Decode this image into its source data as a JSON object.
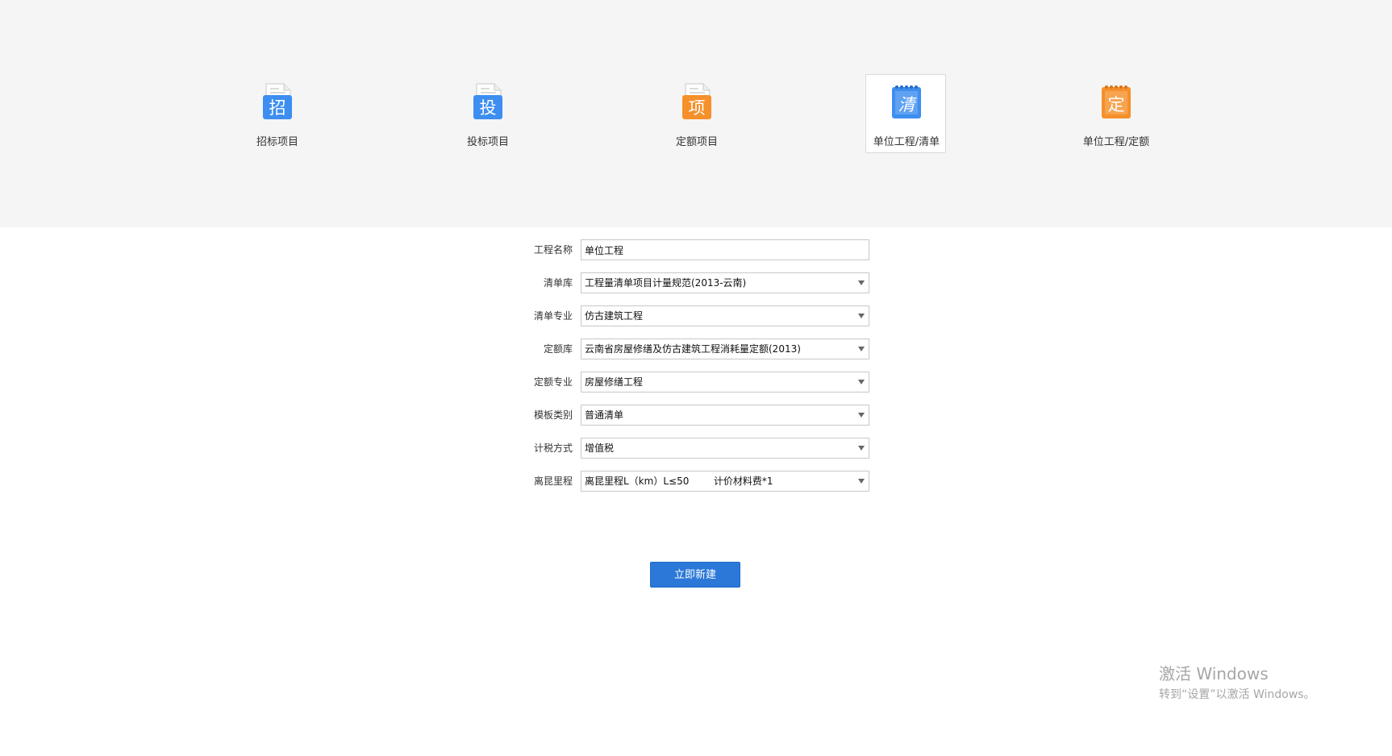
{
  "project_types": [
    {
      "label": "招标项目",
      "glyph": "招",
      "color": "#3d8ef0",
      "icon": "document-icon",
      "selected": false
    },
    {
      "label": "投标项目",
      "glyph": "投",
      "color": "#3d8ef0",
      "icon": "document-icon",
      "selected": false
    },
    {
      "label": "定额项目",
      "glyph": "项",
      "color": "#f5902a",
      "icon": "document-icon",
      "selected": false
    },
    {
      "label": "单位工程/清单",
      "glyph": "清",
      "color": "#3d8ef0",
      "icon": "notepad-icon",
      "selected": true
    },
    {
      "label": "单位工程/定额",
      "glyph": "定",
      "color": "#f5902a",
      "icon": "notepad-icon",
      "selected": false
    }
  ],
  "form": {
    "project_name": {
      "label": "工程名称",
      "value": "单位工程"
    },
    "list_library": {
      "label": "清单库",
      "value": "工程量清单项目计量规范(2013-云南)"
    },
    "list_specialty": {
      "label": "清单专业",
      "value": "仿古建筑工程"
    },
    "quota_library": {
      "label": "定额库",
      "value": "云南省房屋修缮及仿古建筑工程消耗量定额(2013)"
    },
    "quota_specialty": {
      "label": "定额专业",
      "value": "房屋修缮工程"
    },
    "template_type": {
      "label": "模板类别",
      "value": "普通清单"
    },
    "tax_method": {
      "label": "计税方式",
      "value": "增值税"
    },
    "distance": {
      "label": "离昆里程",
      "value": "离昆里程L（km）L≤50        计价材料费*1"
    }
  },
  "actions": {
    "create_label": "立即新建"
  },
  "watermark": {
    "title": "激活 Windows",
    "subtitle": "转到“设置”以激活 Windows。"
  },
  "colors": {
    "accent": "#2b78d8",
    "icon_blue": "#3d8ef0",
    "icon_orange": "#f5902a",
    "top_band": "#f5f5f5"
  }
}
